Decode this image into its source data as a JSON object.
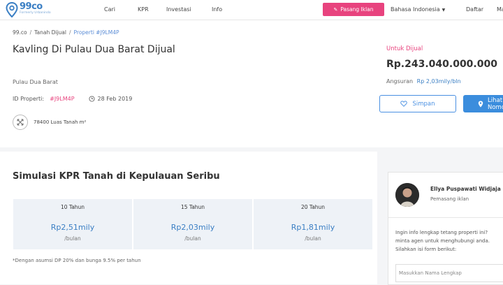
{
  "header": {
    "logo": {
      "name": "99co",
      "tagline": "Formerly Urbanindo"
    },
    "nav": [
      "Cari",
      "KPR",
      "Investasi",
      "Info"
    ],
    "post_ad_label": "Pasang Iklan",
    "language": "Bahasa Indonesia",
    "signup_label": "Daftar",
    "login_partial": "Ma"
  },
  "breadcrumb": {
    "home": "99.co",
    "category": "Tanah Dijual",
    "current": "Properti #J9LM4P"
  },
  "listing": {
    "title": "Kavling Di Pulau Dua Barat Dijual",
    "location": "Pulau Dua Barat",
    "id_label": "ID Properti:",
    "id_value": "#J9LM4P",
    "date": "28 Feb 2019",
    "land_area": "78400 Luas Tanah m²",
    "status": "Untuk Dijual",
    "price": "Rp.243.040.000.000",
    "installment_label": "Angsuran",
    "installment_value": "Rp 2,03mily/bln",
    "save_label": "Simpan",
    "view_label": "Lihat Nomor"
  },
  "simulation": {
    "title": "Simulasi KPR Tanah di Kepulauan Seribu",
    "tenors": [
      {
        "years": "10 Tahun",
        "amount": "Rp2,51mily",
        "unit": "/bulan"
      },
      {
        "years": "15 Tahun",
        "amount": "Rp2,03mily",
        "unit": "/bulan"
      },
      {
        "years": "20 Tahun",
        "amount": "Rp1,81mily",
        "unit": "/bulan"
      }
    ],
    "note": "*Dengan asumsi DP 20% dan bunga 9.5% per tahun"
  },
  "agent": {
    "name": "Ellya Puspawati Widjaja",
    "role": "Pemasang iklan",
    "message": [
      "Ingin info lengkap tetang properti ini?",
      "minta agen untuk menghubungi anda.",
      "Silahkan isi form berikut:"
    ],
    "name_placeholder": "Masukkan Nama Lengkap"
  },
  "colors": {
    "brand_blue": "#3b7fc4",
    "accent_pink": "#e8437e",
    "button_blue": "#3b8ddd"
  }
}
